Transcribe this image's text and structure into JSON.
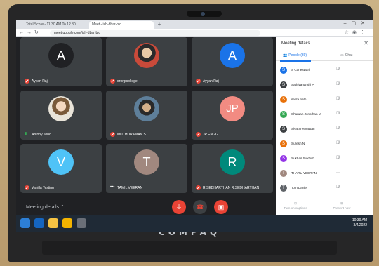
{
  "laptop": {
    "brand": "COMPAQ"
  },
  "browser": {
    "tabs": [
      {
        "label": "Total Score - 11.30 AM To 12.30"
      },
      {
        "label": "Meet - ixh-dbar-bic"
      }
    ],
    "new_tab_label": "+",
    "url": "meet.google.com/ixh-dbar-bic"
  },
  "tiles": [
    {
      "name": "Ayyan Raj",
      "initial": "A",
      "avatar_color": "#3c4043",
      "muted": true
    },
    {
      "name": "drnrjpcollege",
      "initial": "",
      "avatar_color": "",
      "muted": true
    },
    {
      "name": "Ayyan Raj",
      "initial": "A",
      "avatar_color": "#1a73e8",
      "muted": true
    },
    {
      "name": "Antony Jeno",
      "initial": "",
      "avatar_color": "",
      "muted": false
    },
    {
      "name": "MUTHURAMAN S",
      "initial": "",
      "avatar_color": "",
      "muted": true
    },
    {
      "name": "JP ENGG",
      "initial": "JP",
      "avatar_color": "#f28b82",
      "muted": true
    },
    {
      "name": "Vanilla Testing",
      "initial": "V",
      "avatar_color": "#4fc3f7",
      "muted": true
    },
    {
      "name": "TAMIL VEERAN",
      "initial": "T",
      "avatar_color": "#a1887f",
      "muted": false
    },
    {
      "name": "R.SEDHARTHAN R.SEDHARTHAN",
      "initial": "R",
      "avatar_color": "#00897b",
      "muted": true
    }
  ],
  "controls": {
    "meeting_details_label": "Meeting details",
    "mic_icon": "mic-off-icon",
    "end_icon": "call-end-icon",
    "cam_icon": "camera-off-icon"
  },
  "panel": {
    "title": "Meeting details",
    "people_tab": "People (39)",
    "chat_tab": "Chat",
    "participants": [
      {
        "initial": "S",
        "name": "S Cuneswari",
        "color": "#1a73e8"
      },
      {
        "initial": "S",
        "name": "Sathiyanarahi P",
        "color": "#3c4043"
      },
      {
        "initial": "S",
        "name": "sarita nath",
        "color": "#e8710a"
      },
      {
        "initial": "S",
        "name": "Sharuah Jonathan M",
        "color": "#34a853"
      },
      {
        "initial": "S",
        "name": "Siva Sreevatsan",
        "color": "#3c4043"
      },
      {
        "initial": "S",
        "name": "Suresh N",
        "color": "#e8710a"
      },
      {
        "initial": "S",
        "name": "Sukhas Sukhish",
        "color": "#9334e6"
      },
      {
        "initial": "T",
        "name": "THARU VEERAN",
        "color": "#a1887f"
      },
      {
        "initial": "T",
        "name": "Tom Daniel",
        "color": "#5f6368"
      }
    ],
    "footer": [
      {
        "label": "Turn on captions"
      },
      {
        "label": "Present now"
      }
    ]
  },
  "taskbar": {
    "time": "10:39 AM",
    "date": "3/4/2022"
  },
  "colors": {
    "mute_red": "#ea4335",
    "accent": "#1a73e8"
  }
}
